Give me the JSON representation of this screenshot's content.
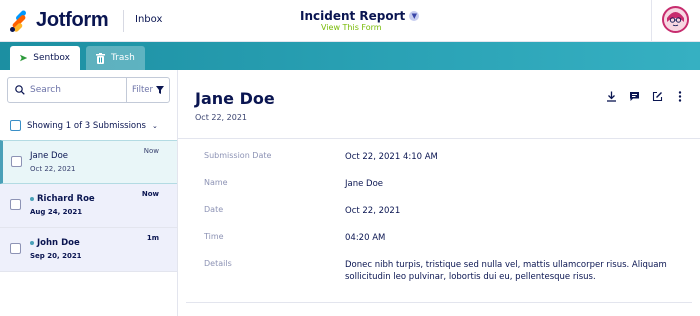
{
  "header": {
    "logo_text": "Jotform",
    "inbox_label": "Inbox",
    "form_title": "Incident Report",
    "view_form_link": "View This Form"
  },
  "tabs": [
    {
      "label": "Sentbox",
      "icon": "sentbox-arrow-icon",
      "active": true
    },
    {
      "label": "Trash",
      "icon": "trash-icon",
      "active": false
    }
  ],
  "sidebar": {
    "search_placeholder": "Search",
    "filter_label": "Filter",
    "count_text": "Showing 1 of 3 Submissions",
    "submissions": [
      {
        "name": "Jane Doe",
        "date": "Oct 22, 2021",
        "time": "Now",
        "selected": true,
        "unread": false
      },
      {
        "name": "Richard Roe",
        "date": "Aug 24, 2021",
        "time": "Now",
        "selected": false,
        "unread": true
      },
      {
        "name": "John Doe",
        "date": "Sep 20, 2021",
        "time": "1m",
        "selected": false,
        "unread": true
      }
    ]
  },
  "detail": {
    "title": "Jane Doe",
    "date": "Oct 22, 2021",
    "actions": [
      "download-icon",
      "comment-icon",
      "edit-icon",
      "more-vertical-icon"
    ],
    "fields": [
      {
        "label": "Submission Date",
        "value": "Oct 22, 2021 4:10 AM"
      },
      {
        "label": "Name",
        "value": "Jane Doe"
      },
      {
        "label": "Date",
        "value": "Oct 22, 2021"
      },
      {
        "label": "Time",
        "value": "04:20 AM"
      },
      {
        "label": "Details",
        "value": "Donec nibh turpis, tristique sed nulla vel, mattis ullamcorper risus. Aliquam sollicitudin leo pulvinar, lobortis dui eu, pellentesque risus."
      }
    ]
  },
  "colors": {
    "brand_navy": "#0a1551",
    "tab_bar": "#2ba3b6",
    "view_form_green": "#78bb07",
    "selected_row": "#e9f6f8",
    "unread_row": "#eef0fb"
  }
}
